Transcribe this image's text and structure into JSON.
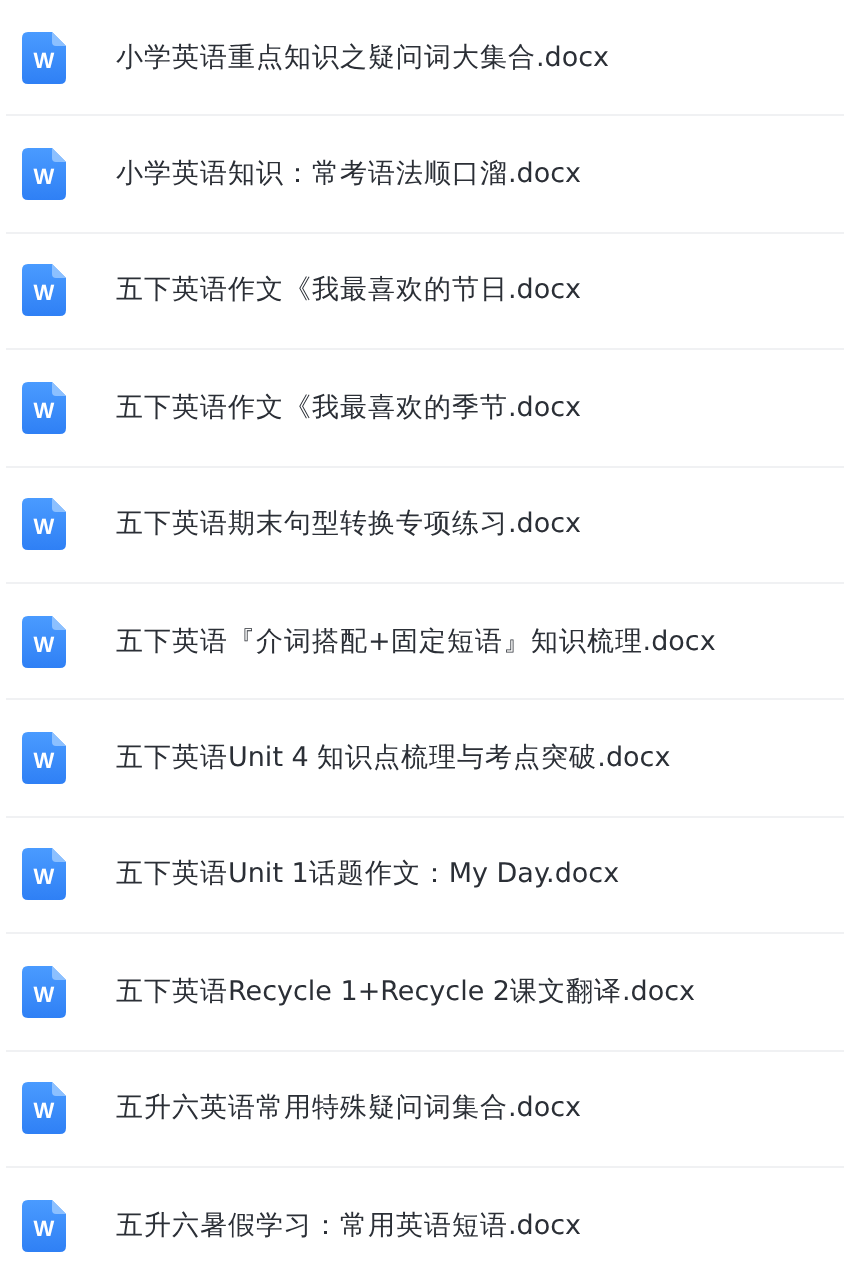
{
  "files": [
    {
      "icon_letter": "W",
      "name": "小学英语重点知识之疑问词大集合.docx"
    },
    {
      "icon_letter": "W",
      "name": "小学英语知识：常考语法顺口溜.docx"
    },
    {
      "icon_letter": "W",
      "name": "五下英语作文《我最喜欢的节日.docx"
    },
    {
      "icon_letter": "W",
      "name": "五下英语作文《我最喜欢的季节.docx"
    },
    {
      "icon_letter": "W",
      "name": "五下英语期末句型转换专项练习.docx"
    },
    {
      "icon_letter": "W",
      "name": "五下英语『介词搭配+固定短语』知识梳理.docx"
    },
    {
      "icon_letter": "W",
      "name": "五下英语Unit 4 知识点梳理与考点突破.docx"
    },
    {
      "icon_letter": "W",
      "name": "五下英语Unit 1话题作文：My Day.docx"
    },
    {
      "icon_letter": "W",
      "name": "五下英语Recycle 1+Recycle 2课文翻译.docx"
    },
    {
      "icon_letter": "W",
      "name": "五升六英语常用特殊疑问词集合.docx"
    },
    {
      "icon_letter": "W",
      "name": "五升六暑假学习：常用英语短语.docx"
    }
  ]
}
